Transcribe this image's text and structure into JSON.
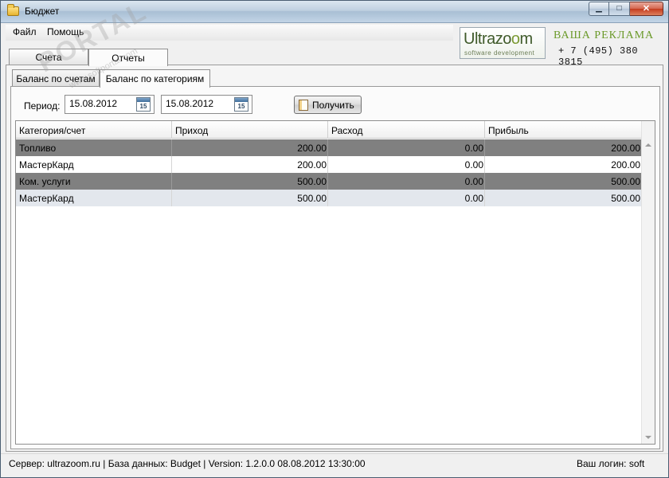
{
  "window": {
    "title": "Бюджет",
    "controls": {
      "minimize": "▁",
      "maximize": "□",
      "close": "✕"
    }
  },
  "menu": {
    "file": "Файл",
    "help": "Помощь"
  },
  "top_tabs": {
    "accounts": "Счета",
    "reports": "Отчеты"
  },
  "ad": {
    "logo_part1": "Ultrazo",
    "logo_part2": "o",
    "logo_part3": "m",
    "logo_sub": "software development",
    "title": "ВАША РЕКЛАМА",
    "phone": "+ 7 (495) 380 3815"
  },
  "inner_tabs": {
    "by_accounts": "Баланс по счетам",
    "by_categories": "Баланс по категориям"
  },
  "filter": {
    "period_label": "Период:",
    "date_from": "15.08.2012",
    "date_to": "15.08.2012",
    "calendar_day": "15",
    "get_button": "Получить"
  },
  "table": {
    "columns": [
      "Категория/счет",
      "Приход",
      "Расход",
      "Прибыль"
    ],
    "rows": [
      {
        "name": "Топливо",
        "income": "200.00",
        "expense": "0.00",
        "profit": "200.00",
        "style": "dark"
      },
      {
        "name": "МастерКард",
        "income": "200.00",
        "expense": "0.00",
        "profit": "200.00",
        "style": "light"
      },
      {
        "name": "Ком. услуги",
        "income": "500.00",
        "expense": "0.00",
        "profit": "500.00",
        "style": "dark"
      },
      {
        "name": "МастерКард",
        "income": "500.00",
        "expense": "0.00",
        "profit": "500.00",
        "style": "selected"
      }
    ]
  },
  "status": {
    "info": "Сервер: ultrazoom.ru  |  База данных: Budget  |  Version: 1.2.0.0 08.08.2012 13:30:00",
    "login": "Ваш логин: soft"
  },
  "watermark": {
    "brand": "PORTAL",
    "site": "www.softportal.com"
  }
}
